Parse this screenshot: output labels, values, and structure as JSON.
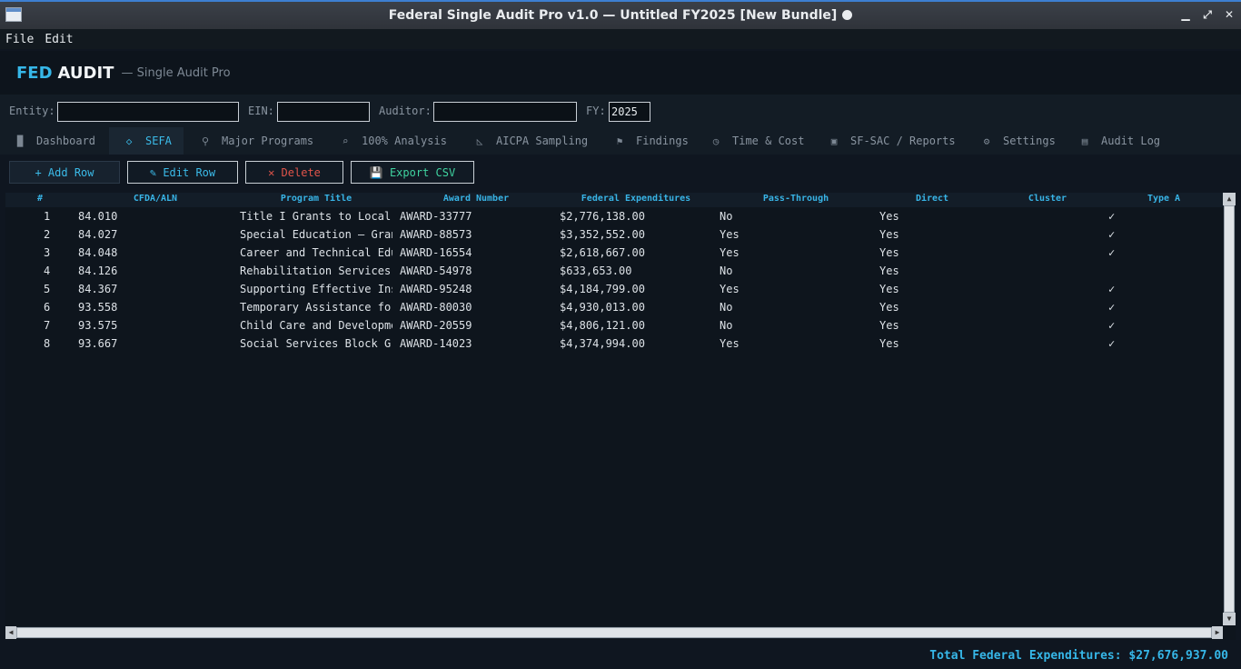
{
  "window": {
    "title": "Federal Single Audit Pro v1.0  —  Untitled FY2025  [New Bundle]"
  },
  "menu": [
    "File",
    "Edit"
  ],
  "header": {
    "brand_primary": "FED",
    "brand_secondary": "AUDIT",
    "subtitle": "— Single Audit Pro"
  },
  "entity": {
    "entity_label": "Entity:",
    "entity_value": "",
    "ein_label": "EIN:",
    "ein_value": "",
    "auditor_label": "Auditor:",
    "auditor_value": "",
    "fy_label": "FY:",
    "fy_value": "2025"
  },
  "tabs": [
    {
      "label": "Dashboard",
      "icon": "bar-chart-icon"
    },
    {
      "label": "SEFA",
      "icon": "tag-icon"
    },
    {
      "label": "Major Programs",
      "icon": "search-icon"
    },
    {
      "label": "100% Analysis",
      "icon": "magnifier-icon"
    },
    {
      "label": "AICPA Sampling",
      "icon": "triangle-ruler-icon"
    },
    {
      "label": "Findings",
      "icon": "flag-icon"
    },
    {
      "label": "Time & Cost",
      "icon": "stopwatch-icon"
    },
    {
      "label": "SF-SAC / Reports",
      "icon": "document-stack-icon"
    },
    {
      "label": "Settings",
      "icon": "gear-icon"
    },
    {
      "label": "Audit Log",
      "icon": "scroll-icon"
    }
  ],
  "active_tab": "SEFA",
  "toolbar": {
    "add_label": "+ Add Row",
    "edit_label": "✎ Edit Row",
    "delete_label": "✕ Delete",
    "export_label": "💾 Export CSV"
  },
  "table": {
    "columns": [
      "#",
      "CFDA/ALN",
      "Program Title",
      "Award Number",
      "Federal Expenditures",
      "Pass-Through",
      "Direct",
      "Cluster",
      "Type A"
    ],
    "rows": [
      [
        "1",
        "84.010",
        "Title I Grants to Local",
        "AWARD-33777",
        "$2,776,138.00",
        "No",
        "Yes",
        "",
        "✓"
      ],
      [
        "2",
        "84.027",
        "Special Education — Gran",
        "AWARD-88573",
        "$3,352,552.00",
        "Yes",
        "Yes",
        "",
        "✓"
      ],
      [
        "3",
        "84.048",
        "Career and Technical Edu",
        "AWARD-16554",
        "$2,618,667.00",
        "Yes",
        "Yes",
        "",
        "✓"
      ],
      [
        "4",
        "84.126",
        "Rehabilitation Services",
        "AWARD-54978",
        "$633,653.00",
        "No",
        "Yes",
        "",
        ""
      ],
      [
        "5",
        "84.367",
        "Supporting Effective Ins",
        "AWARD-95248",
        "$4,184,799.00",
        "Yes",
        "Yes",
        "",
        "✓"
      ],
      [
        "6",
        "93.558",
        "Temporary Assistance for",
        "AWARD-80030",
        "$4,930,013.00",
        "No",
        "Yes",
        "",
        "✓"
      ],
      [
        "7",
        "93.575",
        "Child Care and Developme",
        "AWARD-20559",
        "$4,806,121.00",
        "No",
        "Yes",
        "",
        "✓"
      ],
      [
        "8",
        "93.667",
        "Social Services Block Gr",
        "AWARD-14023",
        "$4,374,994.00",
        "Yes",
        "Yes",
        "",
        "✓"
      ]
    ]
  },
  "footer": {
    "total": "Total Federal Expenditures: $27,676,937.00"
  },
  "colors": {
    "accent": "#36b7e8",
    "danger": "#e0544a",
    "success": "#3fd3a0",
    "background": "#0f1620"
  }
}
